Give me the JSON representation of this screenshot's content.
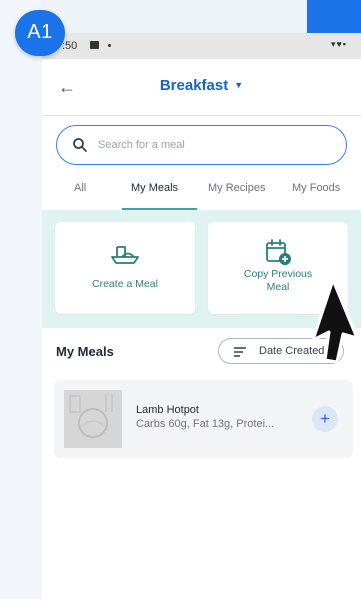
{
  "badge": {
    "label": "A1"
  },
  "status_bar": {
    "time": ":50"
  },
  "header": {
    "title": "Breakfast"
  },
  "search": {
    "placeholder": "Search for a meal"
  },
  "tabs": [
    {
      "label": "All",
      "active": false
    },
    {
      "label": "My Meals",
      "active": true
    },
    {
      "label": "My Recipes",
      "active": false
    },
    {
      "label": "My Foods",
      "active": false
    }
  ],
  "actions": {
    "create_meal": {
      "label": "Create a Meal",
      "icon": "meal-tray-icon"
    },
    "copy_previous": {
      "label_line1": "Copy Previous",
      "label_line2": "Meal",
      "icon": "calendar-add-icon"
    }
  },
  "section": {
    "title": "My Meals"
  },
  "sort": {
    "label": "Date Created"
  },
  "meals": [
    {
      "name": "Lamb Hotpot",
      "macros": "Carbs 60g, Fat 13g, Protei..."
    }
  ],
  "colors": {
    "accent_blue": "#1565c0",
    "teal": "#2a7f7a",
    "tab_underline": "#3aa6a0",
    "card_area_bg": "#e0f3f3",
    "badge_blue": "#1a73e8"
  }
}
